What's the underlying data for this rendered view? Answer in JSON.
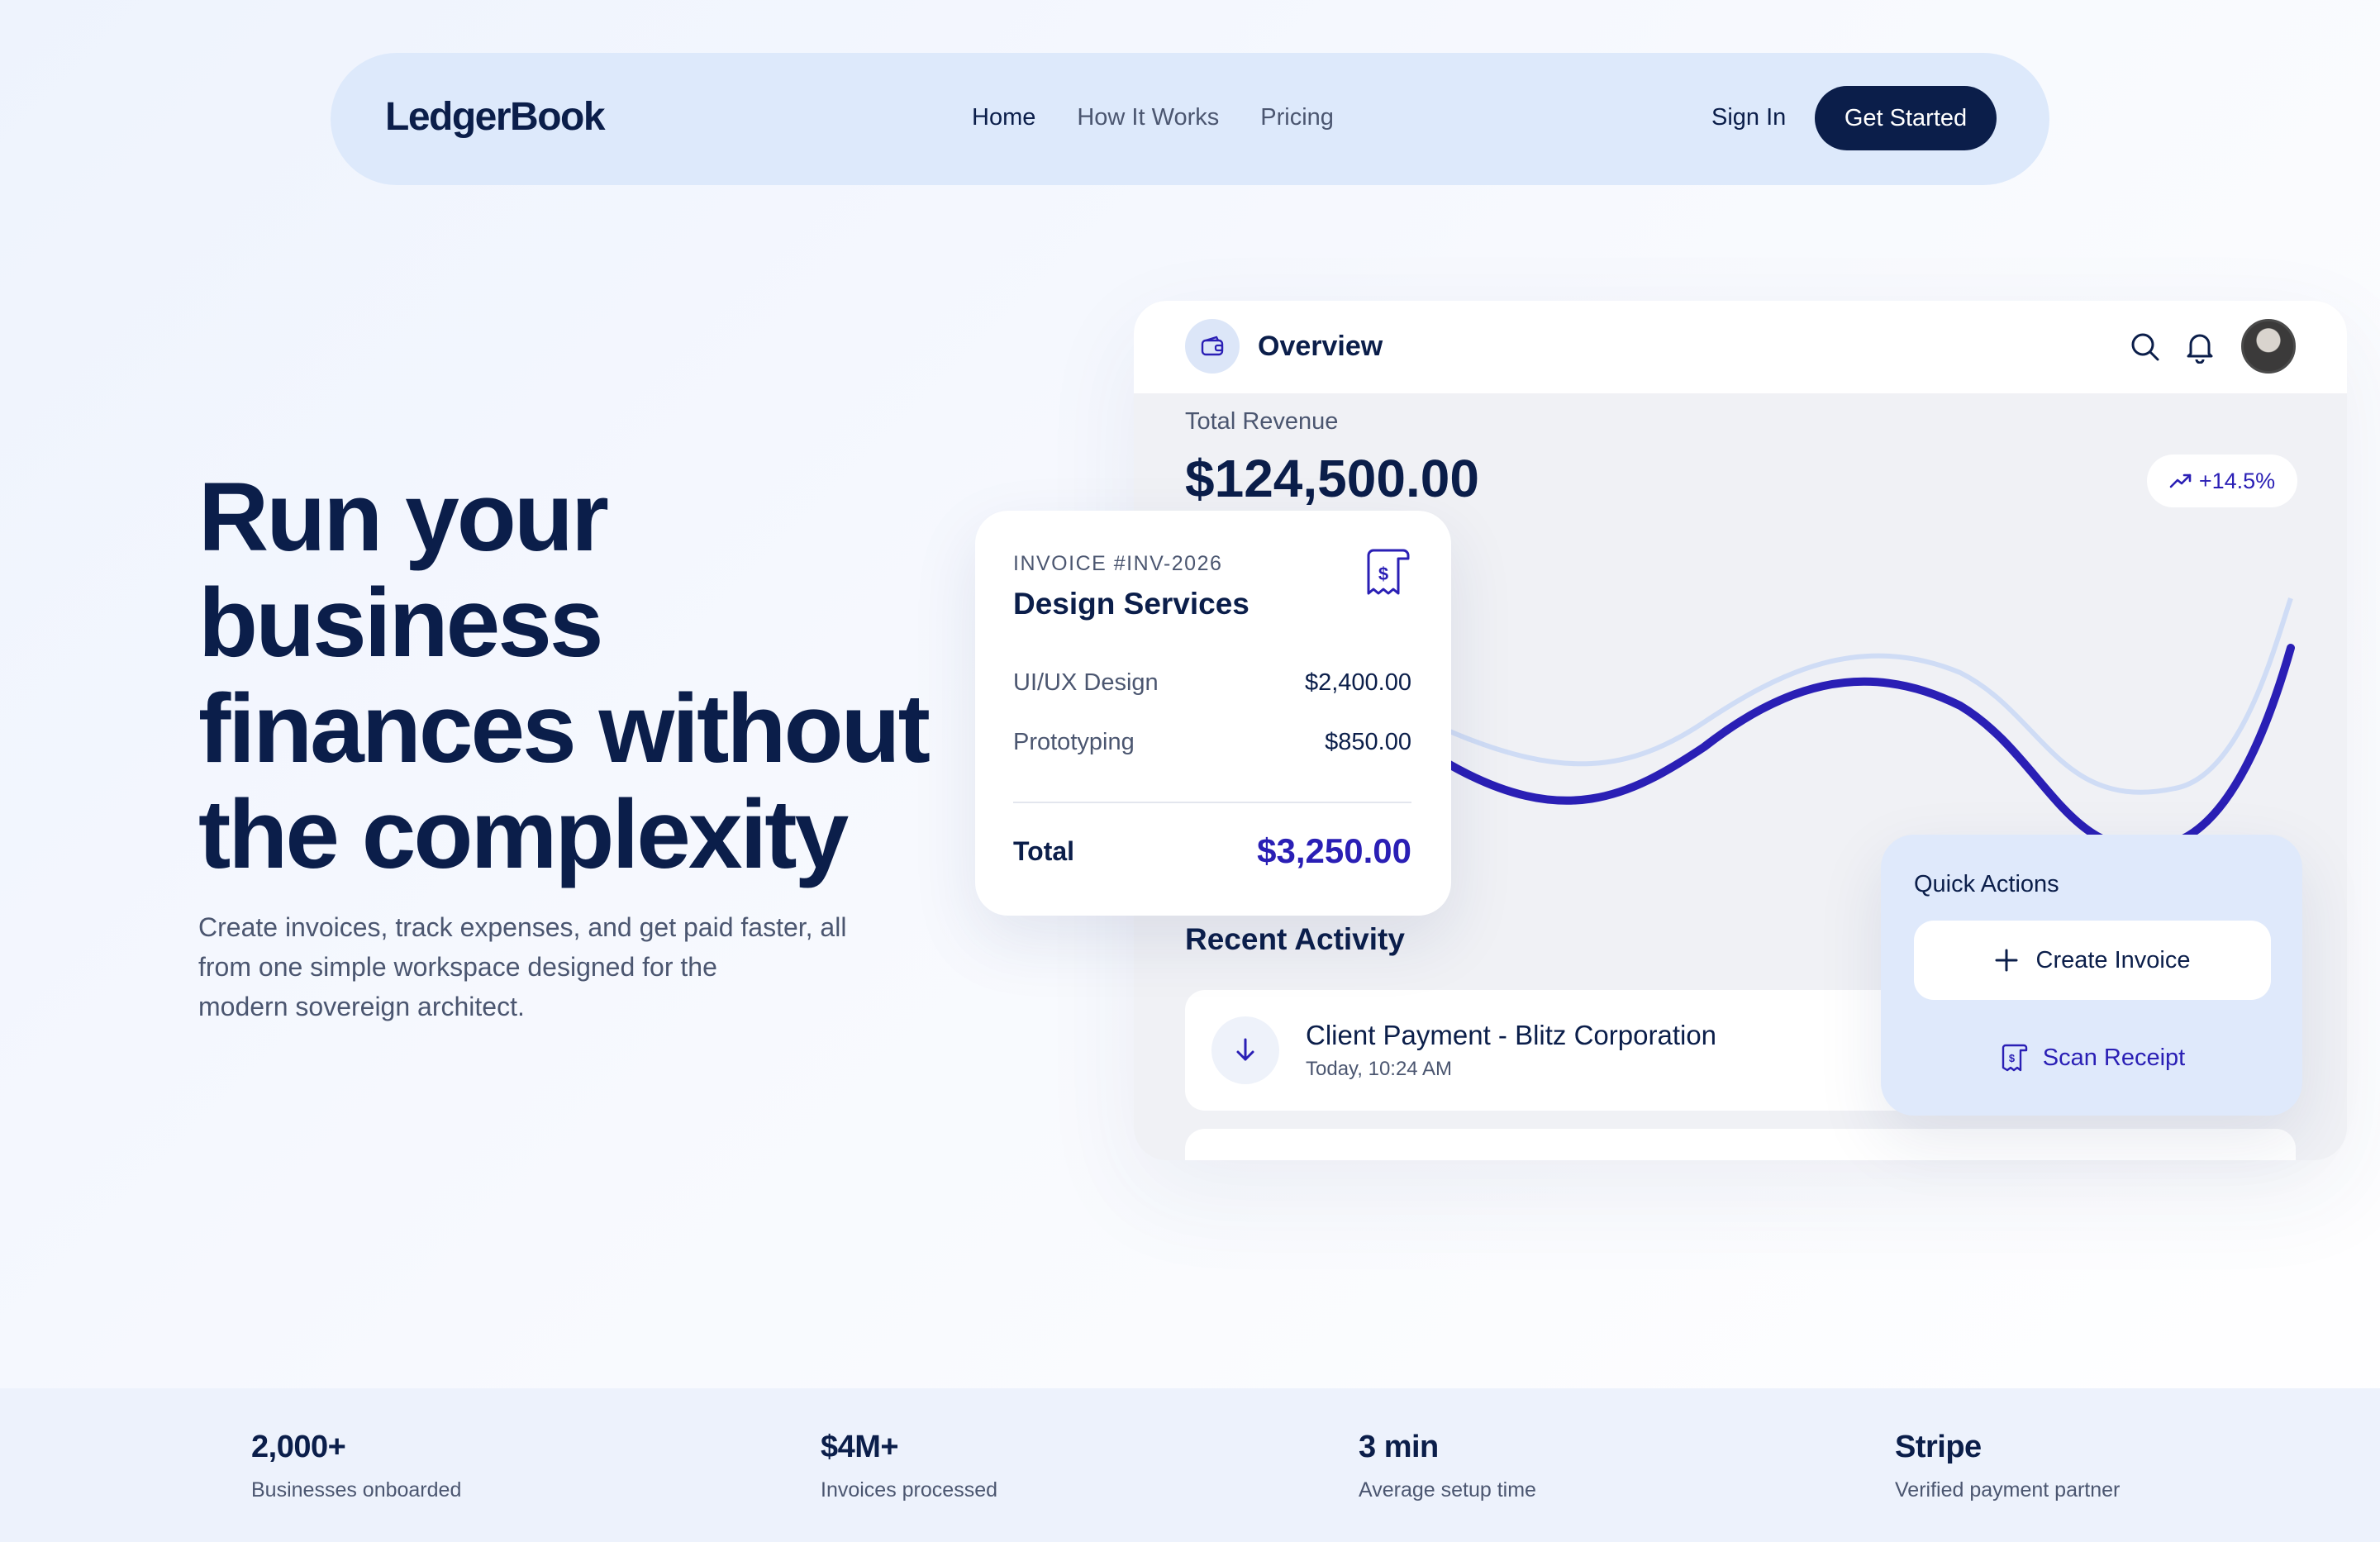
{
  "nav": {
    "logo": "LedgerBook",
    "links": [
      "Home",
      "How It Works",
      "Pricing"
    ],
    "sign_in": "Sign In",
    "cta": "Get Started"
  },
  "hero": {
    "title_lines": [
      "Run your",
      "business",
      "finances without",
      "the complexity"
    ],
    "subtitle_lines": [
      "Create invoices, track expenses, and get paid faster, all",
      "from one simple workspace designed for the",
      "modern sovereign architect."
    ]
  },
  "dashboard": {
    "title": "Overview",
    "wallet_icon": "wallet-icon",
    "search_icon": "search-icon",
    "bell_icon": "bell-icon",
    "revenue_label": "Total Revenue",
    "revenue_value": "$124,500.00",
    "growth": "+14.5%",
    "recent_title": "Recent Activity",
    "activity": [
      {
        "title": "Client Payment - Blitz Corporation",
        "time": "Today, 10:24 AM"
      }
    ],
    "colors": {
      "accent": "#2a1fb5",
      "accent_light": "#cfdcf5",
      "navy": "#0b1e4a"
    }
  },
  "invoice": {
    "number": "INVOICE #INV-2026",
    "title": "Design Services",
    "lines": [
      {
        "label": "UI/UX Design",
        "amount": "$2,400.00"
      },
      {
        "label": "Prototyping",
        "amount": "$850.00"
      }
    ],
    "total_label": "Total",
    "total_amount": "$3,250.00"
  },
  "quick_actions": {
    "title": "Quick Actions",
    "create": "Create Invoice",
    "scan": "Scan Receipt"
  },
  "stats": [
    {
      "value": "2,000+",
      "label": "Businesses onboarded"
    },
    {
      "value": "$4M+",
      "label": "Invoices processed"
    },
    {
      "value": "3 min",
      "label": "Average setup time"
    },
    {
      "value": "Stripe",
      "label": "Verified payment partner"
    }
  ]
}
